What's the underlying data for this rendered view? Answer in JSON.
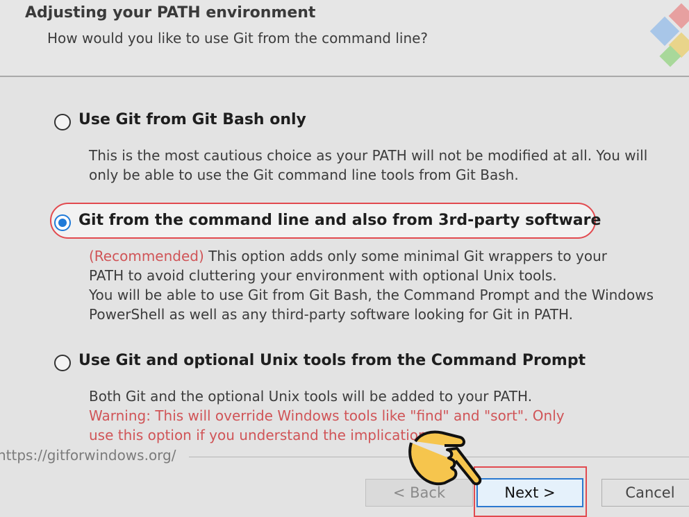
{
  "header": {
    "title": "Adjusting your PATH environment",
    "subtitle": "How would you like to use Git from the command line?"
  },
  "options": [
    {
      "label": "Use Git from Git Bash only",
      "selected": false,
      "lines": [
        "This is the most cautious choice as your PATH will not be modified at all. You will",
        "only be able to use the Git command line tools from Git Bash."
      ]
    },
    {
      "label": "Git from the command line and also from 3rd-party software",
      "selected": true,
      "recommended": "(Recommended)",
      "lines": [
        " This option adds only some minimal Git wrappers to your",
        "PATH to avoid cluttering your environment with optional Unix tools.",
        "You will be able to use Git from Git Bash, the Command Prompt and the Windows",
        "PowerShell as well as any third-party software looking for Git in PATH."
      ]
    },
    {
      "label": "Use Git and optional Unix tools from the Command Prompt",
      "selected": false,
      "lines": [
        "Both Git and the optional Unix tools will be added to your PATH."
      ],
      "warning_lines": [
        "Warning: This will override Windows tools like \"find\" and \"sort\". Only",
        "use this option if you understand the implications."
      ]
    }
  ],
  "footer": {
    "url": "https://gitforwindows.org/",
    "back_label": "< Back",
    "next_label": "Next >",
    "cancel_label": "Cancel"
  },
  "colors": {
    "accent_blue": "#1f7ad8",
    "highlight_red": "#e24a4f",
    "warning_red": "#d05457"
  },
  "icons": [
    "git-logo-icon",
    "pointing-hand-icon"
  ]
}
